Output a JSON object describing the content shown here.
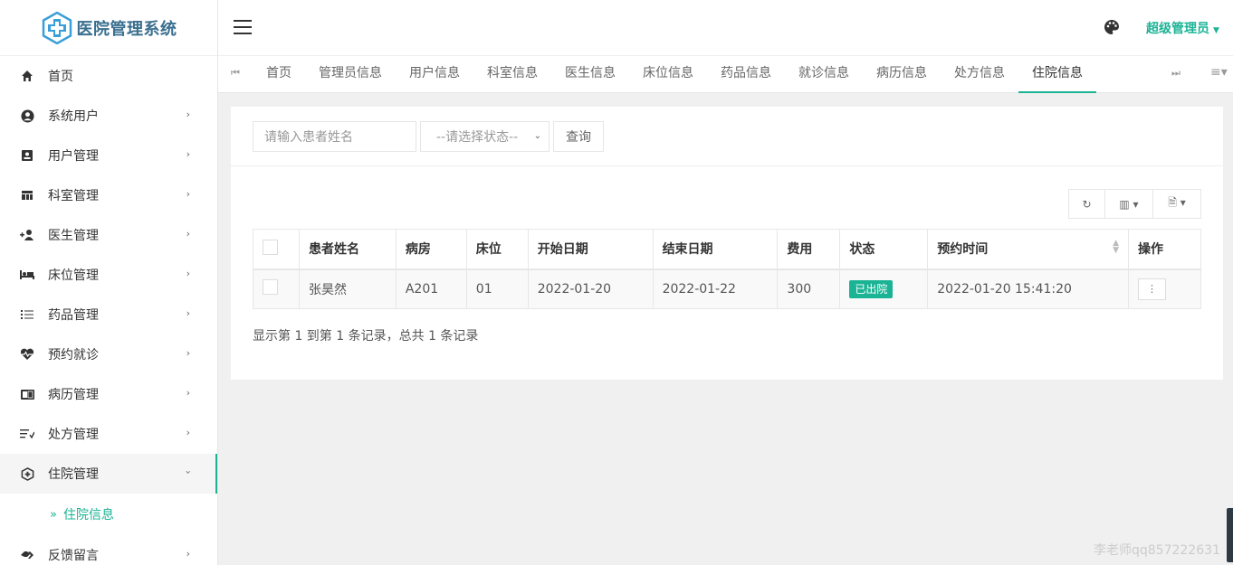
{
  "app": {
    "title": "医院管理系统"
  },
  "sidebar": {
    "items": [
      {
        "label": "首页",
        "icon": "home-icon"
      },
      {
        "label": "系统用户",
        "icon": "user-circle-icon"
      },
      {
        "label": "用户管理",
        "icon": "id-card-icon"
      },
      {
        "label": "科室管理",
        "icon": "columns-icon"
      },
      {
        "label": "医生管理",
        "icon": "user-plus-icon"
      },
      {
        "label": "床位管理",
        "icon": "bed-icon"
      },
      {
        "label": "药品管理",
        "icon": "list-icon"
      },
      {
        "label": "预约就诊",
        "icon": "heartbeat-icon"
      },
      {
        "label": "病历管理",
        "icon": "book-icon"
      },
      {
        "label": "处方管理",
        "icon": "sort-list-icon"
      },
      {
        "label": "住院管理",
        "icon": "hospital-icon"
      },
      {
        "label": "反馈留言",
        "icon": "handshake-icon"
      }
    ],
    "active_sub": "住院信息"
  },
  "header": {
    "user": "超级管理员"
  },
  "tabs": [
    "首页",
    "管理员信息",
    "用户信息",
    "科室信息",
    "医生信息",
    "床位信息",
    "药品信息",
    "就诊信息",
    "病历信息",
    "处方信息",
    "住院信息"
  ],
  "search": {
    "name_placeholder": "请输入患者姓名",
    "status_selected": "--请选择状态--",
    "query_label": "查询"
  },
  "table": {
    "columns": [
      "患者姓名",
      "病房",
      "床位",
      "开始日期",
      "结束日期",
      "费用",
      "状态",
      "预约时间",
      "操作"
    ],
    "rows": [
      {
        "name": "张昊然",
        "ward": "A201",
        "bed": "01",
        "start": "2022-01-20",
        "end": "2022-01-22",
        "fee": "300",
        "status": "已出院",
        "time": "2022-01-20 15:41:20"
      }
    ]
  },
  "pagination": {
    "summary": "显示第 1 到第 1 条记录，总共 1 条记录"
  },
  "watermark": "李老师qq857222631",
  "colors": {
    "accent": "#1ab394",
    "logo": "#3a9fd8"
  }
}
